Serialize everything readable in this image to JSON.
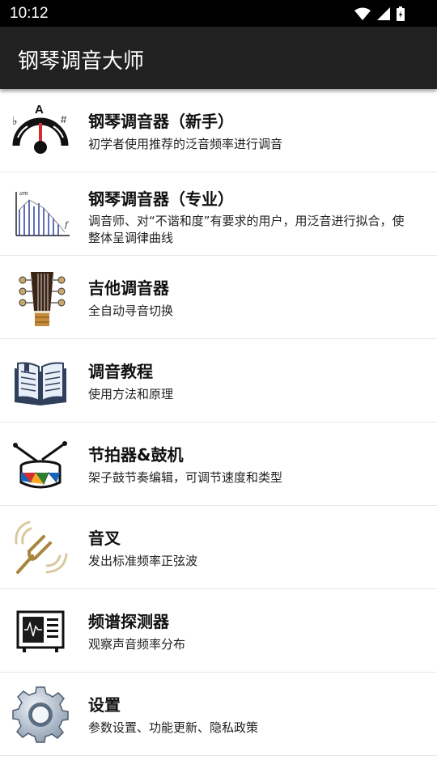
{
  "status": {
    "time": "10:12"
  },
  "app": {
    "title": "钢琴调音大师"
  },
  "items": [
    {
      "title": "钢琴调音器（新手）",
      "desc": "初学者使用推荐的泛音频率进行调音",
      "icon": "tuner-gauge-icon"
    },
    {
      "title": "钢琴调音器（专业）",
      "desc": "调音师、对“不谐和度”有要求的用户，用泛音进行拟合，使整体呈调律曲线",
      "icon": "spectrum-graph-icon"
    },
    {
      "title": "吉他调音器",
      "desc": "全自动寻音切换",
      "icon": "guitar-headstock-icon"
    },
    {
      "title": "调音教程",
      "desc": "使用方法和原理",
      "icon": "open-book-icon"
    },
    {
      "title": "节拍器&鼓机",
      "desc": "架子鼓节奏编辑，可调节速度和类型",
      "icon": "drum-icon"
    },
    {
      "title": "音叉",
      "desc": "发出标准频率正弦波",
      "icon": "tuning-fork-icon"
    },
    {
      "title": "频谱探测器",
      "desc": "观察声音频率分布",
      "icon": "spectrum-monitor-icon"
    },
    {
      "title": "设置",
      "desc": "参数设置、功能更新、隐私政策",
      "icon": "gear-icon"
    }
  ],
  "tuner_icon_labels": {
    "flat": "♭",
    "note": "A",
    "sharp": "#"
  },
  "graph_icon_labels": {
    "amp": "am",
    "freq": "f"
  },
  "colors": {
    "status_bar": "#000000",
    "app_bar": "#212121",
    "divider": "#e6e6e6"
  }
}
